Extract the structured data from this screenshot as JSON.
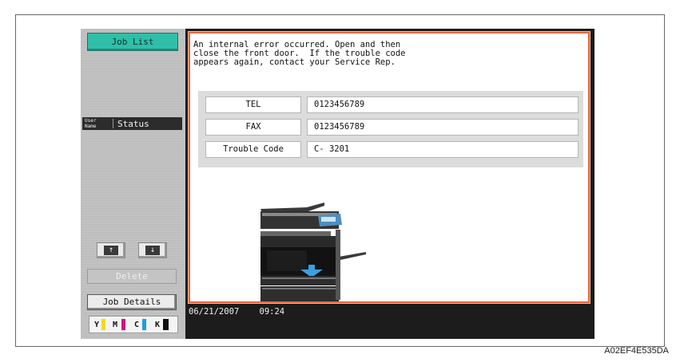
{
  "left_panel": {
    "job_list_label": "Job List",
    "header_user_name": "User\nName",
    "header_status": "Status",
    "scroll_up_glyph": "↑",
    "scroll_down_glyph": "↓",
    "delete_label": "Delete",
    "job_details_label": "Job Details",
    "toner": [
      {
        "letter": "Y",
        "color": "#f2dc00"
      },
      {
        "letter": "M",
        "color": "#d0147c"
      },
      {
        "letter": "C",
        "color": "#1e9fd8"
      },
      {
        "letter": "K",
        "color": "#111111"
      }
    ]
  },
  "dialog": {
    "message_lines": [
      "An internal error occurred. Open and then",
      "close the front door.  If the trouble code",
      "appears again, contact your Service Rep."
    ],
    "rows": [
      {
        "label": "TEL",
        "value": "0123456789"
      },
      {
        "label": "FAX",
        "value": "0123456789"
      },
      {
        "label": "Trouble Code",
        "value": "C- 3201"
      }
    ],
    "accent_color": "#e4643c"
  },
  "status_bar": {
    "date": "06/21/2007",
    "time": "09:24"
  },
  "figure_code": "A02EF4E535DA"
}
